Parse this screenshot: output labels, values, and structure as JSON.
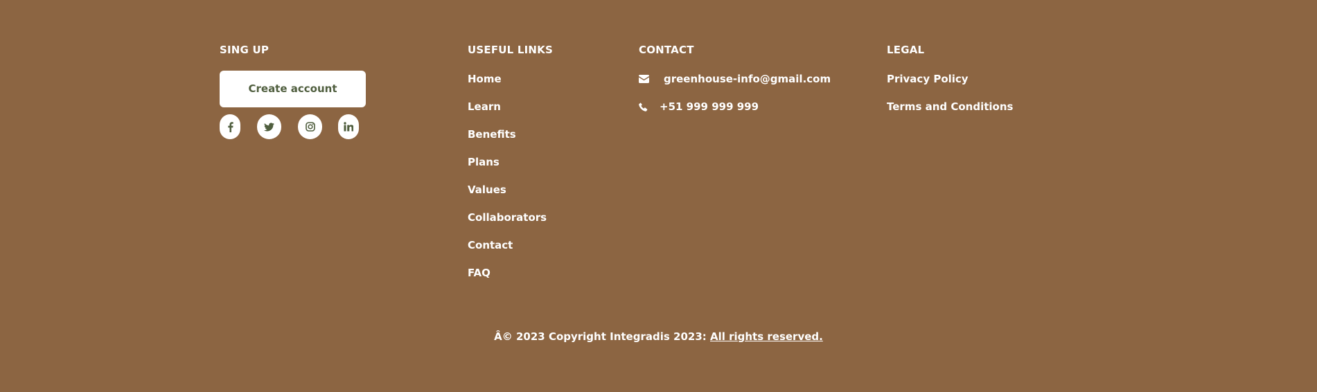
{
  "colors": {
    "background": "#8c6542",
    "text": "#ffffff",
    "button_bg": "#ffffff",
    "button_text": "#4f5e3e"
  },
  "signup": {
    "title": "SING UP",
    "button_label": "Create account",
    "socials": [
      {
        "name": "facebook",
        "icon": "facebook-icon"
      },
      {
        "name": "twitter",
        "icon": "twitter-icon"
      },
      {
        "name": "instagram",
        "icon": "instagram-icon"
      },
      {
        "name": "linkedin",
        "icon": "linkedin-icon"
      }
    ]
  },
  "links": {
    "title": "USEFUL LINKS",
    "items": [
      "Home",
      "Learn",
      "Benefits",
      "Plans",
      "Values",
      "Collaborators",
      "Contact",
      "FAQ"
    ]
  },
  "contact": {
    "title": "CONTACT",
    "email": "greenhouse-info@gmail.com",
    "email_icon": "envelope-icon",
    "phone": "+51 999 999 999",
    "phone_icon": "phone-icon"
  },
  "legal": {
    "title": "LEGAL",
    "items": [
      "Privacy Policy",
      "Terms and Conditions"
    ]
  },
  "copyright": {
    "text": "Â© 2023 Copyright Integradis 2023: ",
    "link": "All rights reserved."
  }
}
